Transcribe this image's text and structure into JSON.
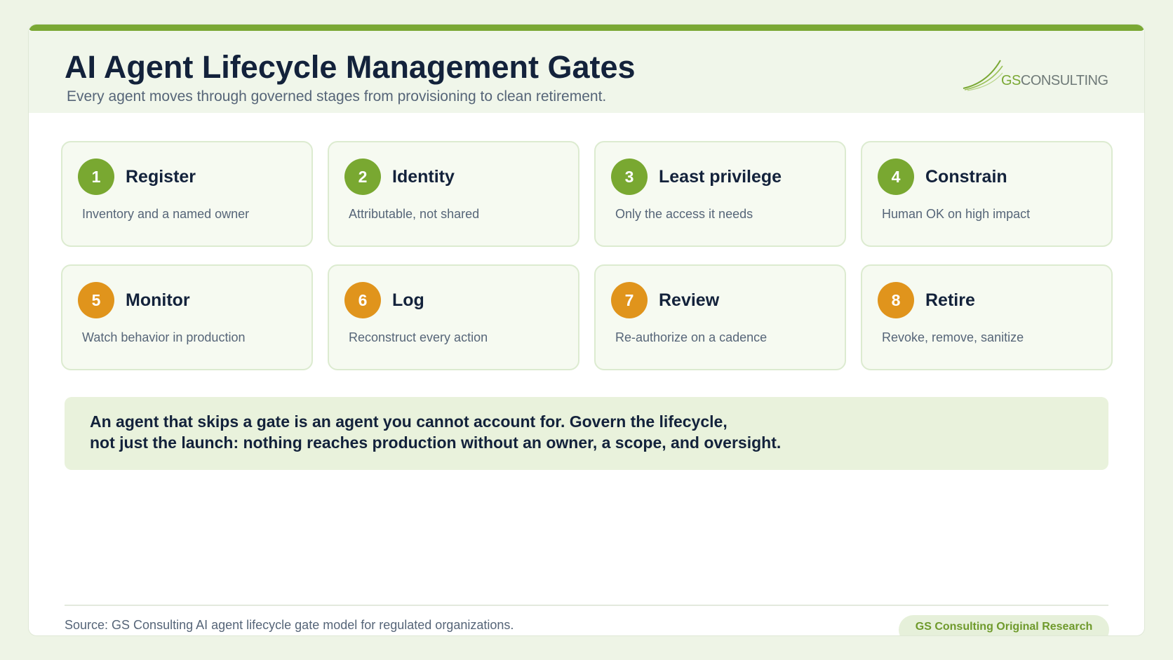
{
  "header": {
    "title": "AI Agent Lifecycle Management Gates",
    "subtitle": "Every agent moves through governed stages from provisioning to clean retirement."
  },
  "logo": {
    "brand_prefix": "GS",
    "brand_suffix": "CONSULTING"
  },
  "gates": [
    {
      "number": "1",
      "title": "Register",
      "description": "Inventory and a named owner",
      "color": "#79a831"
    },
    {
      "number": "2",
      "title": "Identity",
      "description": "Attributable, not shared",
      "color": "#79a831"
    },
    {
      "number": "3",
      "title": "Least privilege",
      "description": "Only the access it needs",
      "color": "#79a831"
    },
    {
      "number": "4",
      "title": "Constrain",
      "description": "Human OK on high impact",
      "color": "#79a831"
    },
    {
      "number": "5",
      "title": "Monitor",
      "description": "Watch behavior in production",
      "color": "#e0941c"
    },
    {
      "number": "6",
      "title": "Log",
      "description": "Reconstruct every action",
      "color": "#e0941c"
    },
    {
      "number": "7",
      "title": "Review",
      "description": "Re-authorize on a cadence",
      "color": "#e0941c"
    },
    {
      "number": "8",
      "title": "Retire",
      "description": "Revoke, remove, sanitize",
      "color": "#e0941c"
    }
  ],
  "callout": {
    "line1": "An agent that skips a gate is an agent you cannot account for. Govern the lifecycle,",
    "line2": "not just the launch: nothing reaches production without an owner, a scope, and oversight."
  },
  "footer": {
    "source": "Source: GS Consulting AI agent lifecycle gate model for regulated organizations.",
    "tag": "GS Consulting Original Research"
  },
  "colors": {
    "accent_green": "#7aa834",
    "accent_orange": "#e0941c",
    "navy": "#13223b"
  }
}
